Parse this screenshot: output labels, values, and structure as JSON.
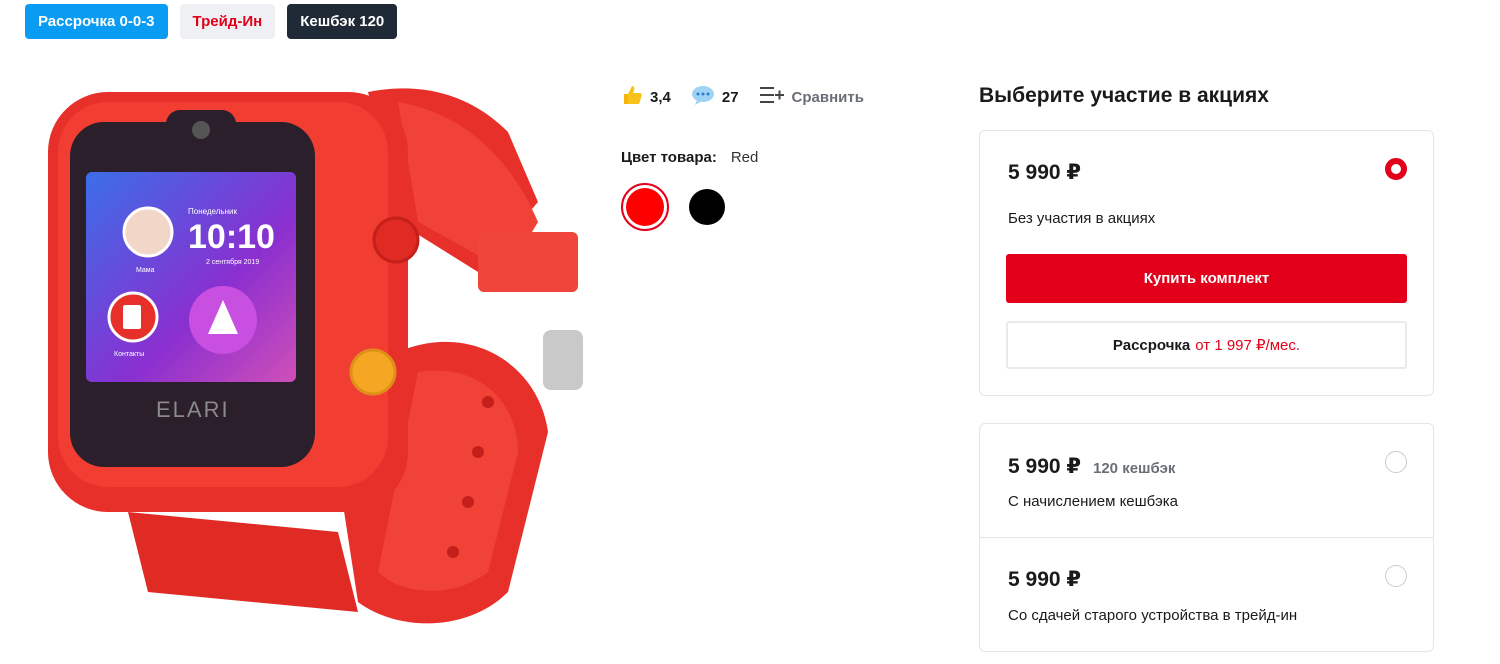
{
  "badges": [
    {
      "label": "Рассрочка 0-0-3"
    },
    {
      "label": "Трейд-Ин"
    },
    {
      "label": "Кешбэк 120"
    }
  ],
  "product": {
    "image_alt": "Red ELARI kids smartwatch",
    "screen_time": "10:10",
    "screen_day": "Понедельник",
    "screen_date": "2 сентября 2019",
    "screen_contact": "Мама",
    "screen_contacts": "Контакты",
    "brand": "ELARI"
  },
  "meta": {
    "rating": "3,4",
    "reviews": "27",
    "compare_label": "Сравнить"
  },
  "color": {
    "label": "Цвет товара:",
    "value": "Red"
  },
  "promo": {
    "title": "Выберите участие в акциях",
    "options": [
      {
        "price": "5 990 ₽",
        "desc": "Без участия в акциях",
        "selected": true
      },
      {
        "price": "5 990 ₽",
        "cashback": "120 кешбэк",
        "desc": "С начислением кешбэка",
        "selected": false
      },
      {
        "price": "5 990 ₽",
        "desc": "Со сдачей старого устройства в трейд-ин",
        "selected": false
      }
    ],
    "buy_label": "Купить комплект",
    "credit_label": "Рассрочка",
    "credit_amount": "от 1 997 ₽/мес."
  },
  "colors": {
    "accent": "#e2001a",
    "badge_blue": "#0a9cf2",
    "badge_dark": "#1f2a36"
  }
}
